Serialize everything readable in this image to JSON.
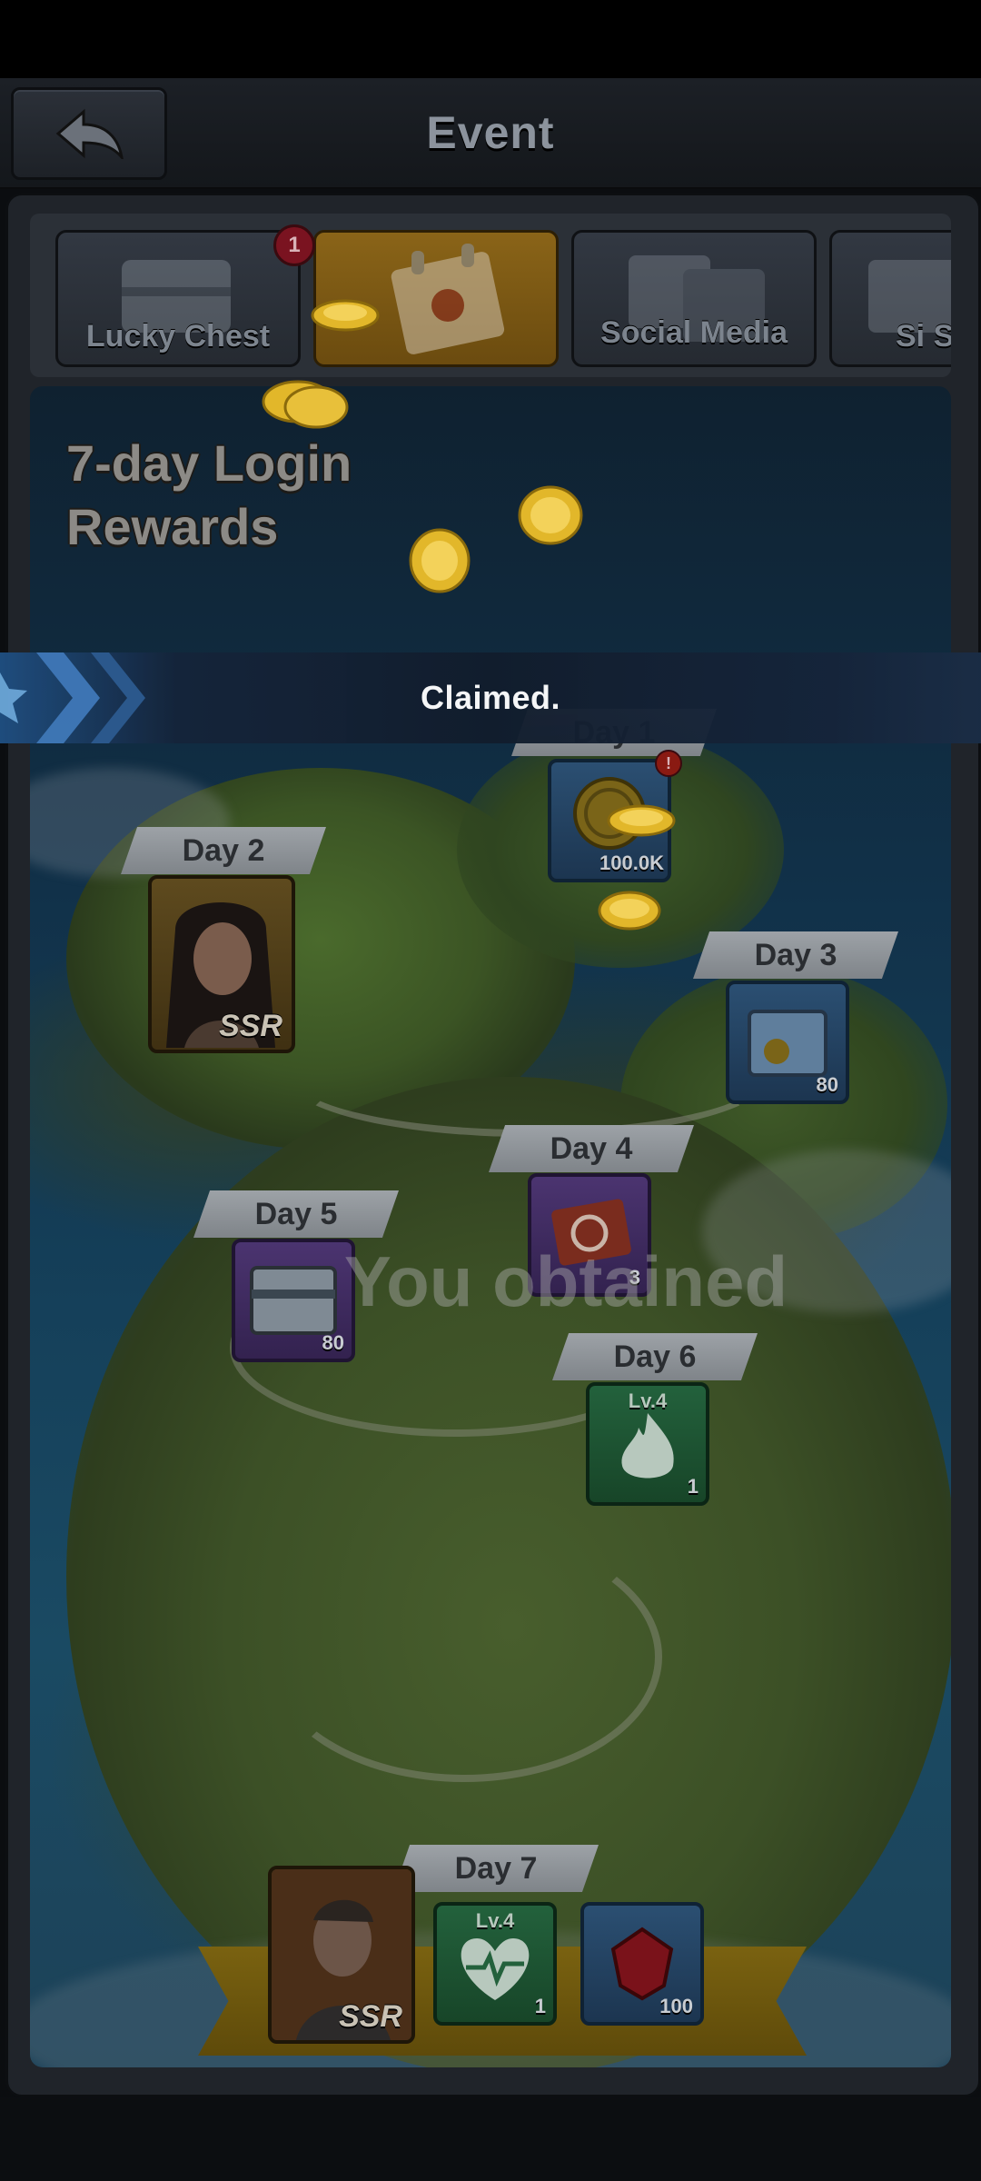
{
  "header": {
    "title": "Event",
    "back_icon": "back-arrow-icon"
  },
  "tabs": [
    {
      "label": "Lucky Chest",
      "badge": "1",
      "active": false,
      "icon": "chest-icon"
    },
    {
      "label": "",
      "active": true,
      "icon": "calendar-icon"
    },
    {
      "label": "Social Media",
      "active": false,
      "icon": "social-media-icon"
    },
    {
      "label": "Si Scra",
      "active": false,
      "icon": "scratch-icon"
    }
  ],
  "event": {
    "title_line1": "7-day Login",
    "title_line2": "Rewards"
  },
  "days": [
    {
      "label": "Day 1",
      "rewards": [
        {
          "icon": "gold-coin-icon",
          "qty": "100.0K",
          "alert": "!"
        }
      ]
    },
    {
      "label": "Day 2",
      "rewards": [
        {
          "icon": "hero-portrait-female",
          "tag": "SSR"
        }
      ]
    },
    {
      "label": "Day 3",
      "rewards": [
        {
          "icon": "coin-crate-icon",
          "qty": "80"
        }
      ]
    },
    {
      "label": "Day 4",
      "rewards": [
        {
          "icon": "skill-card-icon",
          "qty": "3"
        }
      ]
    },
    {
      "label": "Day 5",
      "rewards": [
        {
          "icon": "supply-crate-icon",
          "qty": "80"
        }
      ]
    },
    {
      "label": "Day 6",
      "rewards": [
        {
          "icon": "fire-skill-icon",
          "level": "Lv.4",
          "qty": "1"
        }
      ]
    },
    {
      "label": "Day 7",
      "rewards": [
        {
          "icon": "hero-portrait-male",
          "tag": "SSR"
        },
        {
          "icon": "heart-skill-icon",
          "level": "Lv.4",
          "qty": "1"
        },
        {
          "icon": "ruby-gem-icon",
          "qty": "100"
        }
      ]
    }
  ],
  "toast": {
    "text": "Claimed.",
    "overlay_text": "You obtained"
  },
  "colors": {
    "accent_gold": "#8a6418",
    "banner_blue": "#1f4f82",
    "badge_red": "#7a1320"
  }
}
